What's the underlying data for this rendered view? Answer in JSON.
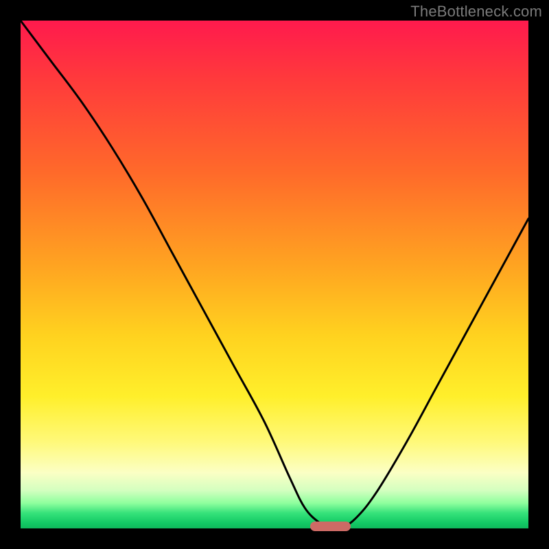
{
  "watermark": "TheBottleneck.com",
  "colors": {
    "frame_bg": "#000000",
    "curve_stroke": "#000000",
    "marker_fill": "#cd6a65",
    "watermark_text": "#7b7b7b"
  },
  "chart_data": {
    "type": "line",
    "title": "",
    "xlabel": "",
    "ylabel": "",
    "xlim": [
      0,
      100
    ],
    "ylim": [
      0,
      100
    ],
    "series": [
      {
        "name": "bottleneck-curve",
        "x": [
          0,
          6,
          12,
          18,
          24,
          30,
          36,
          42,
          48,
          53,
          56,
          59,
          61,
          63,
          66,
          70,
          76,
          82,
          88,
          94,
          100
        ],
        "values": [
          100,
          92,
          84,
          75,
          65,
          54,
          43,
          32,
          21,
          10,
          4,
          1,
          0,
          0,
          2,
          7,
          17,
          28,
          39,
          50,
          61
        ]
      }
    ],
    "annotations": [
      {
        "name": "optimal-marker",
        "x_start": 57,
        "x_end": 65,
        "y": 0
      }
    ],
    "background_gradient": {
      "orientation": "vertical",
      "stops": [
        {
          "pos": 0.0,
          "color": "#ff1a4d"
        },
        {
          "pos": 0.3,
          "color": "#ff6a2a"
        },
        {
          "pos": 0.62,
          "color": "#ffd21f"
        },
        {
          "pos": 0.89,
          "color": "#fbffc4"
        },
        {
          "pos": 1.0,
          "color": "#0fb85c"
        }
      ]
    }
  }
}
